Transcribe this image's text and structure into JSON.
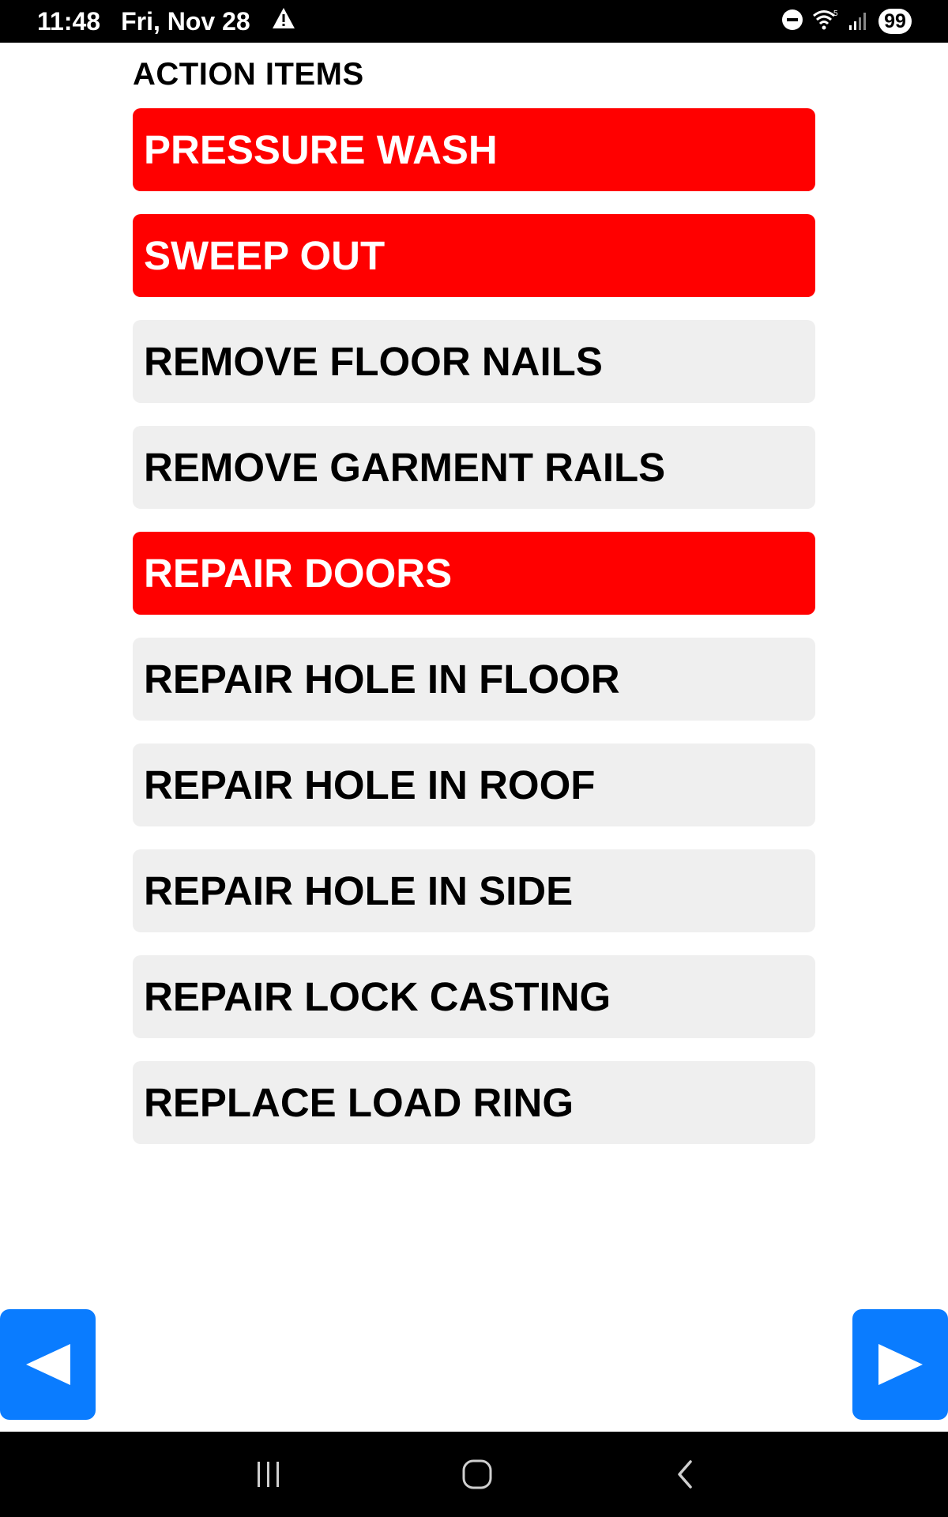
{
  "status_bar": {
    "time": "11:48",
    "date": "Fri, Nov 28",
    "battery": "99",
    "icons": [
      "warning-icon",
      "dnd-icon",
      "wifi-icon",
      "signal-icon"
    ]
  },
  "section": {
    "title": "ACTION ITEMS"
  },
  "action_items": [
    {
      "label": "PRESSURE WASH",
      "flagged": true
    },
    {
      "label": "SWEEP OUT",
      "flagged": true
    },
    {
      "label": "REMOVE FLOOR NAILS",
      "flagged": false
    },
    {
      "label": "REMOVE GARMENT RAILS",
      "flagged": false
    },
    {
      "label": "REPAIR DOORS",
      "flagged": true
    },
    {
      "label": "REPAIR HOLE IN FLOOR",
      "flagged": false
    },
    {
      "label": "REPAIR HOLE IN ROOF",
      "flagged": false
    },
    {
      "label": "REPAIR HOLE IN SIDE",
      "flagged": false
    },
    {
      "label": "REPAIR LOCK CASTING",
      "flagged": false
    },
    {
      "label": "REPLACE LOAD RING",
      "flagged": false
    }
  ],
  "navigation": {
    "prev_icon": "triangle-left-icon",
    "next_icon": "triangle-right-icon"
  },
  "system_nav": {
    "icons": [
      "recents-icon",
      "home-icon",
      "back-icon"
    ]
  },
  "colors": {
    "flagged_bg": "#ff0000",
    "normal_bg": "#efefef",
    "nav_blue": "#0a7cff",
    "bar_bg": "#000000"
  }
}
